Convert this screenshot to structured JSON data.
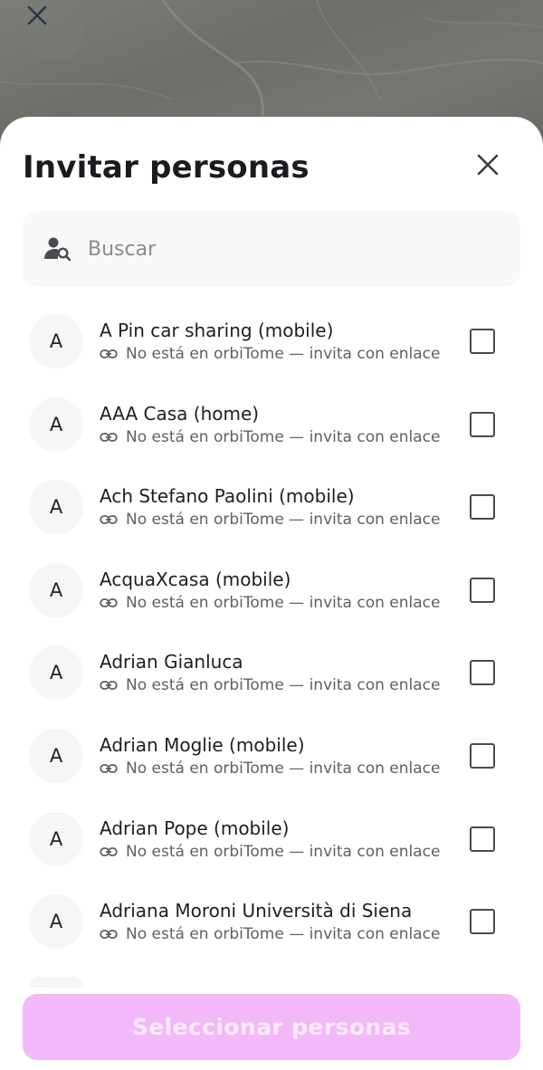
{
  "sheet": {
    "title": "Invitar personas"
  },
  "search": {
    "placeholder": "Buscar"
  },
  "contacts": [
    {
      "initial": "A",
      "name": "A Pin car sharing (mobile)",
      "status": "No está en orbiTome — invita con enlace"
    },
    {
      "initial": "A",
      "name": "AAA Casa (home)",
      "status": "No está en orbiTome — invita con enlace"
    },
    {
      "initial": "A",
      "name": "Ach Stefano Paolini (mobile)",
      "status": "No está en orbiTome — invita con enlace"
    },
    {
      "initial": "A",
      "name": "AcquaXcasa (mobile)",
      "status": "No está en orbiTome — invita con enlace"
    },
    {
      "initial": "A",
      "name": "Adrian Gianluca",
      "status": "No está en orbiTome — invita con enlace"
    },
    {
      "initial": "A",
      "name": "Adrian Moglie (mobile)",
      "status": "No está en orbiTome — invita con enlace"
    },
    {
      "initial": "A",
      "name": "Adrian Pope (mobile)",
      "status": "No está en orbiTome — invita con enlace"
    },
    {
      "initial": "A",
      "name": "Adriana Moroni Università di Siena",
      "status": "No está en orbiTome — invita con enlace"
    }
  ],
  "cta": {
    "label": "Seleccionar personas"
  },
  "icons": {
    "map_close": "close-icon",
    "sheet_close": "close-icon",
    "search": "person-search-icon",
    "link": "link-icon"
  },
  "colors": {
    "cta_background": "#f3b8fa",
    "cta_text": "#fbeafd"
  }
}
